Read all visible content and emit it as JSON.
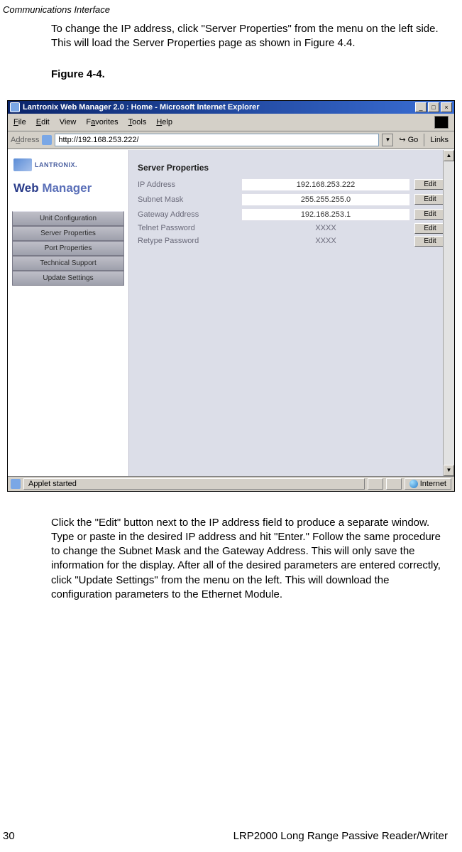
{
  "page_header": "Communications Interface",
  "intro_para": "To change the IP address, click \"Server Properties\" from the menu on the left side. This will load the Server Properties page as shown in Figure 4.4.",
  "figure_label": "Figure 4-4.",
  "ie": {
    "title": "Lantronix Web Manager 2.0 : Home - Microsoft Internet Explorer",
    "menu": {
      "file": "File",
      "edit": "Edit",
      "view": "View",
      "favorites": "Favorites",
      "tools": "Tools",
      "help": "Help"
    },
    "address_label": "Address",
    "url": "http://192.168.253.222/",
    "go_label": "Go",
    "links_label": "Links",
    "status_left": "Applet started",
    "status_right": "Internet"
  },
  "wm": {
    "brand": "LANTRONIX.",
    "product_w1": "Web ",
    "product_w2": "Manager",
    "nav": [
      "Unit Configuration",
      "Server Properties",
      "Port Properties",
      "Technical Support",
      "Update Settings"
    ],
    "section_title": "Server Properties",
    "rows": [
      {
        "label": "IP Address",
        "value": "192.168.253.222",
        "box": true
      },
      {
        "label": "Subnet Mask",
        "value": "255.255.255.0",
        "box": true
      },
      {
        "label": "Gateway Address",
        "value": "192.168.253.1",
        "box": true
      },
      {
        "label": "Telnet Password",
        "value": "XXXX",
        "box": false
      },
      {
        "label": "Retype Password",
        "value": "XXXX",
        "box": false
      }
    ],
    "edit_label": "Edit"
  },
  "outro_para": "Click the \"Edit\" button next to the IP address field to produce a separate window. Type or paste in the desired IP address and hit \"Enter.\" Follow the same procedure to change the Subnet Mask and the Gateway Address. This will only save the information for the display. After all of the desired parameters are entered correctly, click \"Update Settings\" from the menu on the left. This will download the configuration parameters to the Ethernet Module.",
  "footer": {
    "page": "30",
    "doc": "LRP2000 Long Range Passive Reader/Writer"
  }
}
